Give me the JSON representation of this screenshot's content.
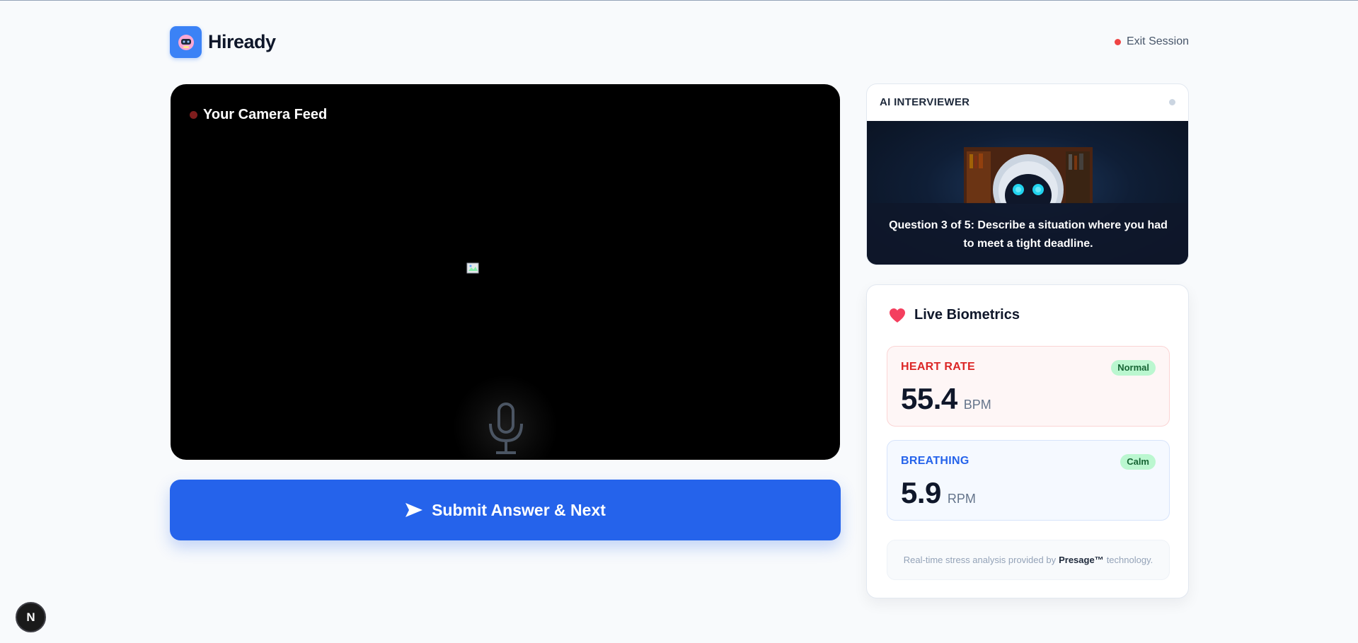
{
  "header": {
    "brand_name": "Hiready",
    "exit_label": "Exit Session"
  },
  "camera": {
    "title": "Your Camera Feed"
  },
  "submit": {
    "label": "Submit Answer & Next"
  },
  "interviewer": {
    "title": "AI INTERVIEWER",
    "question": "Question 3 of 5: Describe a situation where you had to meet a tight deadline."
  },
  "biometrics": {
    "title": "Live Biometrics",
    "heart_rate": {
      "label": "HEART RATE",
      "status": "Normal",
      "value": "55.4",
      "unit": "BPM"
    },
    "breathing": {
      "label": "BREATHING",
      "status": "Calm",
      "value": "5.9",
      "unit": "RPM"
    },
    "footnote_prefix": "Real-time stress analysis provided by",
    "footnote_brand": "Presage™",
    "footnote_suffix": "technology."
  },
  "dev_badge": {
    "label": "N"
  },
  "colors": {
    "accent": "#2563eb",
    "brand_logo": "#3b82f6",
    "heart_rate": "#dc2626",
    "breathing": "#2563eb",
    "status_ok": "#bbf7d0"
  },
  "icons": {
    "brand": "robot-icon",
    "heart": "heart-icon",
    "submit": "send-icon",
    "mic": "microphone-icon"
  }
}
